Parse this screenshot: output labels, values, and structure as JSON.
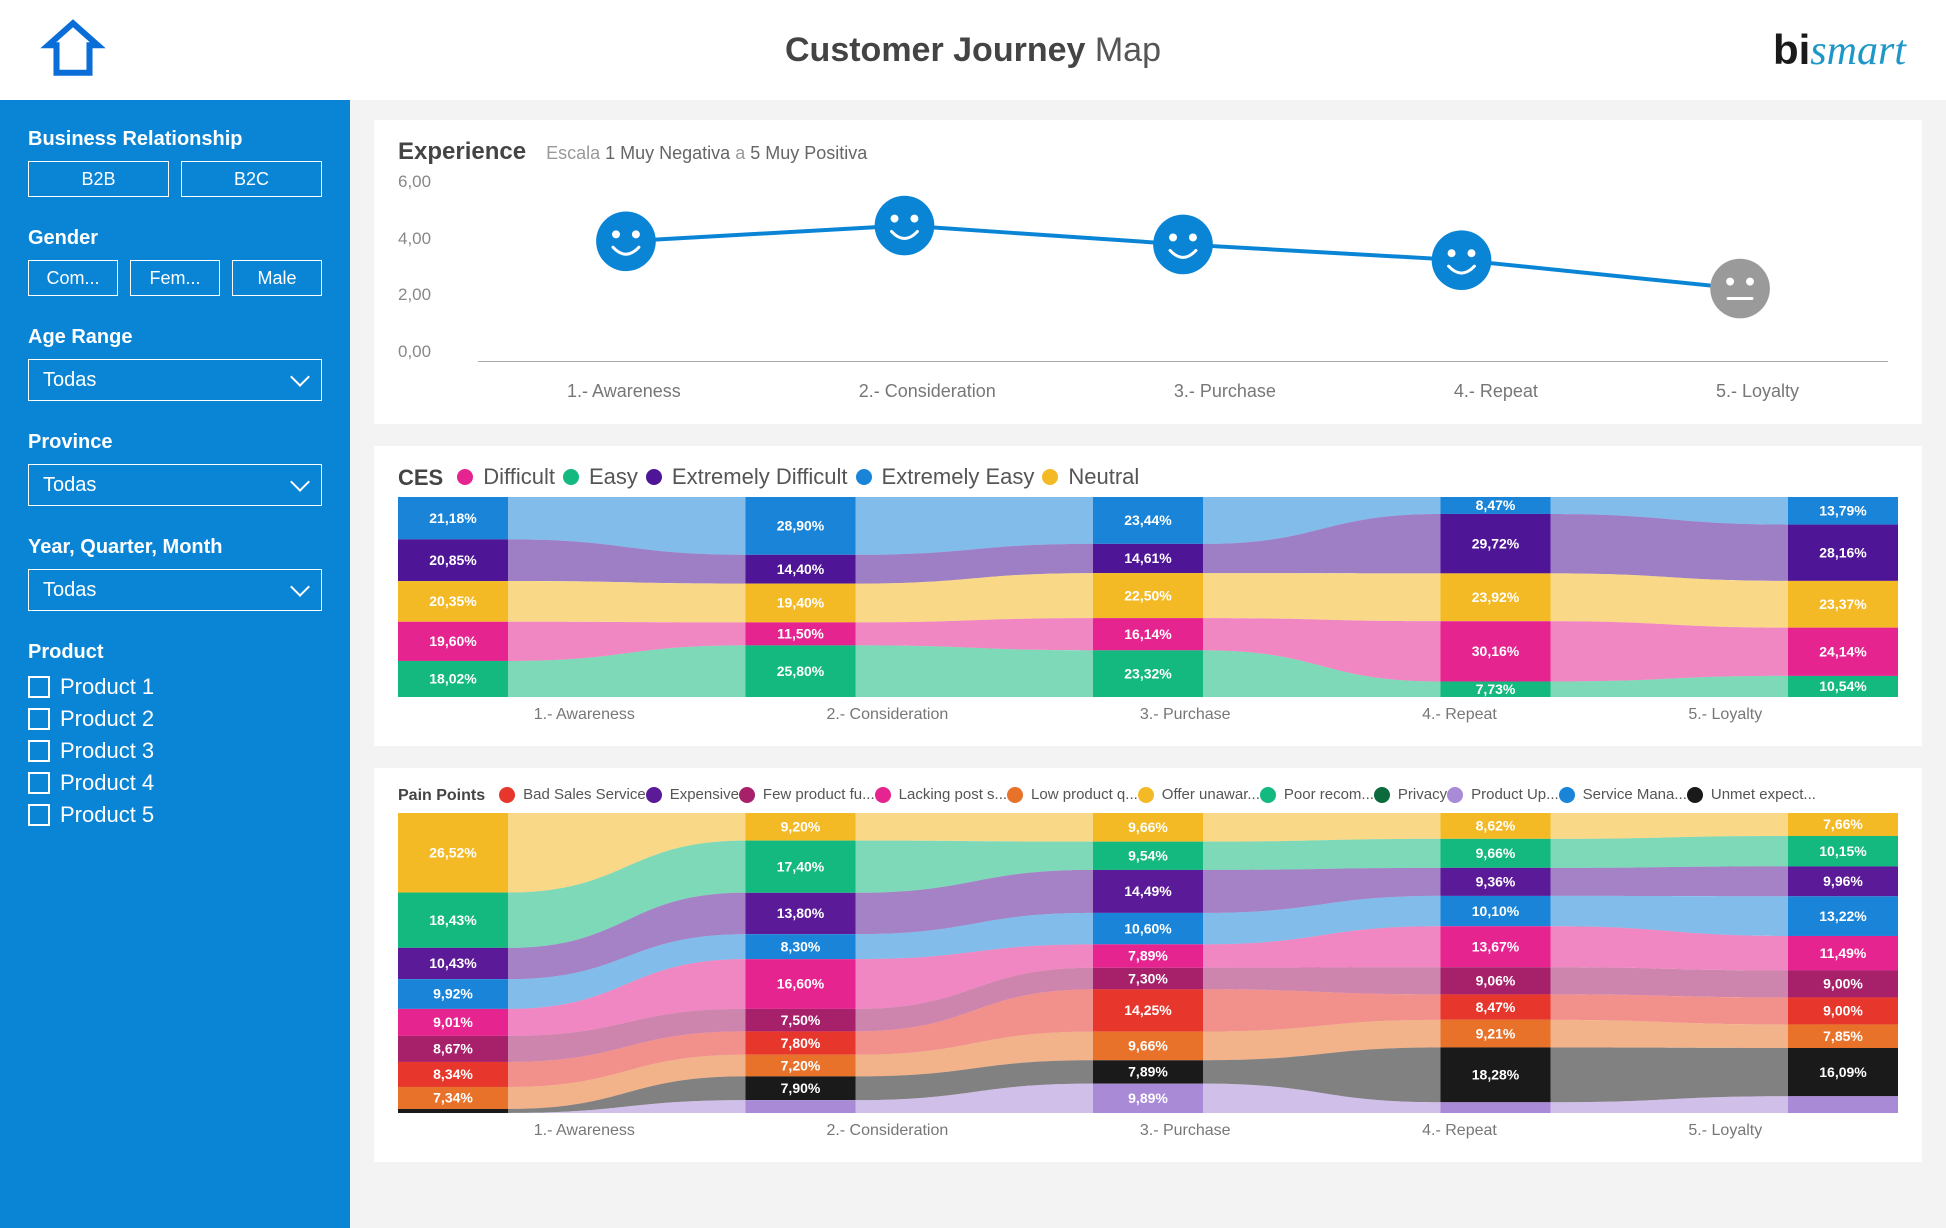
{
  "header": {
    "title_bold": "Customer Journey",
    "title_light": "Map",
    "brand_bi": "bi",
    "brand_smart": "smart"
  },
  "sidebar": {
    "business_label": "Business Relationship",
    "business_opts": [
      "B2B",
      "B2C"
    ],
    "gender_label": "Gender",
    "gender_opts": [
      "Com...",
      "Fem...",
      "Male"
    ],
    "age_label": "Age Range",
    "age_value": "Todas",
    "province_label": "Province",
    "province_value": "Todas",
    "time_label": "Year, Quarter, Month",
    "time_value": "Todas",
    "product_label": "Product",
    "products": [
      "Product 1",
      "Product 2",
      "Product 3",
      "Product 4",
      "Product 5"
    ]
  },
  "experience": {
    "title": "Experience",
    "scale_word": "Escala",
    "scale_low": "1 Muy Negativa",
    "scale_mid": "a",
    "scale_high": "5 Muy Positiva",
    "y_ticks": [
      "6,00",
      "4,00",
      "2,00",
      "0,00"
    ],
    "stages": [
      "1.- Awareness",
      "2.- Consideration",
      "3.- Purchase",
      "4.- Repeat",
      "5.- Loyalty"
    ]
  },
  "ces": {
    "title": "CES",
    "legend": [
      {
        "name": "Difficult",
        "color": "#e62490"
      },
      {
        "name": "Easy",
        "color": "#13b97e"
      },
      {
        "name": "Extremely Difficult",
        "color": "#4f1597"
      },
      {
        "name": "Extremely Easy",
        "color": "#1a85d8"
      },
      {
        "name": "Neutral",
        "color": "#f4ba26"
      }
    ],
    "stages": [
      "1.- Awareness",
      "2.- Consideration",
      "3.- Purchase",
      "4.- Repeat",
      "5.- Loyalty"
    ]
  },
  "painpoints": {
    "title": "Pain Points",
    "legend": [
      {
        "name": "Bad Sales Service",
        "color": "#e7362c"
      },
      {
        "name": "Expensive",
        "color": "#5b1a98"
      },
      {
        "name": "Few product fu...",
        "color": "#a6206a"
      },
      {
        "name": "Lacking post s...",
        "color": "#e62490"
      },
      {
        "name": "Low product q...",
        "color": "#e8722a"
      },
      {
        "name": "Offer unawar...",
        "color": "#f4ba26"
      },
      {
        "name": "Poor recom...",
        "color": "#13b97e"
      },
      {
        "name": "Privacy",
        "color": "#0b6b3d"
      },
      {
        "name": "Product Up...",
        "color": "#a98ad6"
      },
      {
        "name": "Service Mana...",
        "color": "#1a85d8"
      },
      {
        "name": "Unmet expect...",
        "color": "#1a1a1a"
      }
    ],
    "stages": [
      "1.- Awareness",
      "2.- Consideration",
      "3.- Purchase",
      "4.- Repeat",
      "5.- Loyalty"
    ]
  },
  "chart_data": [
    {
      "type": "line",
      "title": "Experience",
      "subtitle": "Escala 1 Muy Negativa a 5 Muy Positiva",
      "categories": [
        "1.- Awareness",
        "2.- Consideration",
        "3.- Purchase",
        "4.- Repeat",
        "5.- Loyalty"
      ],
      "values": [
        3.8,
        4.3,
        3.7,
        3.2,
        2.3
      ],
      "mood": [
        "happy",
        "happy",
        "happy",
        "happy",
        "neutral"
      ],
      "ylim": [
        0,
        6
      ],
      "ylabel": "",
      "xlabel": ""
    },
    {
      "type": "bar",
      "title": "CES",
      "stacked": true,
      "categories": [
        "1.- Awareness",
        "2.- Consideration",
        "3.- Purchase",
        "4.- Repeat",
        "5.- Loyalty"
      ],
      "series": [
        {
          "name": "Extremely Easy",
          "color": "#1a85d8",
          "values": [
            21.18,
            28.9,
            23.44,
            8.47,
            13.79
          ]
        },
        {
          "name": "Extremely Difficult",
          "color": "#4f1597",
          "values": [
            20.85,
            14.4,
            14.61,
            29.72,
            28.16
          ]
        },
        {
          "name": "Neutral",
          "color": "#f4ba26",
          "values": [
            20.35,
            19.4,
            22.5,
            23.92,
            23.37
          ]
        },
        {
          "name": "Difficult",
          "color": "#e62490",
          "values": [
            19.6,
            11.5,
            16.14,
            30.16,
            24.14
          ]
        },
        {
          "name": "Easy",
          "color": "#13b97e",
          "values": [
            18.02,
            25.8,
            23.32,
            7.73,
            10.54
          ]
        }
      ],
      "ylim": [
        0,
        100
      ]
    },
    {
      "type": "bar",
      "title": "Pain Points",
      "stacked": true,
      "categories": [
        "1.- Awareness",
        "2.- Consideration",
        "3.- Purchase",
        "4.- Repeat",
        "5.- Loyalty"
      ],
      "series": [
        {
          "name": "Offer unawar...",
          "color": "#f4ba26",
          "values": [
            26.52,
            9.2,
            9.66,
            8.62,
            7.66
          ]
        },
        {
          "name": "Poor recom...",
          "color": "#13b97e",
          "values": [
            18.43,
            17.4,
            9.54,
            9.66,
            10.15
          ]
        },
        {
          "name": "Expensive",
          "color": "#5b1a98",
          "values": [
            10.43,
            13.8,
            14.49,
            9.36,
            9.96
          ]
        },
        {
          "name": "Service Mana...",
          "color": "#1a85d8",
          "values": [
            9.92,
            8.3,
            10.6,
            10.1,
            13.22
          ]
        },
        {
          "name": "Lacking post s...",
          "color": "#e62490",
          "values": [
            9.01,
            16.6,
            7.89,
            13.67,
            11.49
          ]
        },
        {
          "name": "Few product fu...",
          "color": "#a6206a",
          "values": [
            8.67,
            7.5,
            7.3,
            9.06,
            9.0
          ]
        },
        {
          "name": "Bad Sales Service",
          "color": "#e7362c",
          "values": [
            8.34,
            7.8,
            14.25,
            8.47,
            9.0
          ]
        },
        {
          "name": "Low product q...",
          "color": "#e8722a",
          "values": [
            7.34,
            7.2,
            9.66,
            9.21,
            7.85
          ]
        },
        {
          "name": "Unmet expect...",
          "color": "#1a1a1a",
          "values": [
            1.34,
            7.9,
            7.89,
            18.28,
            16.09
          ]
        },
        {
          "name": "Product Up...",
          "color": "#a98ad6",
          "values": [
            0.0,
            4.3,
            9.89,
            3.57,
            5.58
          ]
        },
        {
          "name": "Privacy",
          "color": "#0b6b3d",
          "values": [
            0.0,
            0.0,
            0.0,
            0.0,
            0.0
          ]
        }
      ],
      "ylim": [
        0,
        100
      ]
    }
  ]
}
